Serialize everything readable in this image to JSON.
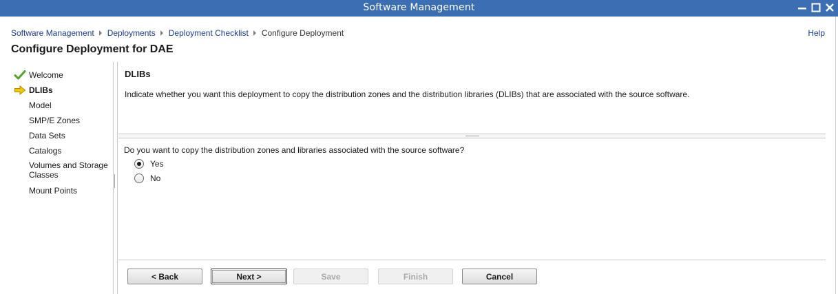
{
  "window": {
    "title": "Software Management"
  },
  "breadcrumb": {
    "items": [
      "Software Management",
      "Deployments",
      "Deployment Checklist"
    ],
    "current": "Configure Deployment"
  },
  "help_label": "Help",
  "page_title": "Configure Deployment for DAE",
  "wizard_steps": [
    {
      "label": "Welcome",
      "status": "complete",
      "icon": "check-icon"
    },
    {
      "label": "DLIBs",
      "status": "current",
      "icon": "arrow-right-icon"
    },
    {
      "label": "Model",
      "status": "pending"
    },
    {
      "label": "SMP/E Zones",
      "status": "pending"
    },
    {
      "label": "Data Sets",
      "status": "pending"
    },
    {
      "label": "Catalogs",
      "status": "pending"
    },
    {
      "label": "Volumes and Storage",
      "label_line2": "Classes",
      "status": "pending"
    },
    {
      "label": "Mount Points",
      "status": "pending"
    }
  ],
  "section": {
    "title": "DLIBs",
    "description": "Indicate whether you want this deployment to copy the distribution zones and the distribution libraries (DLIBs) that are associated with the source software."
  },
  "question": {
    "text": "Do you want to copy the distribution zones and libraries associated with the source software?",
    "options": [
      {
        "label": "Yes",
        "selected": true
      },
      {
        "label": "No",
        "selected": false
      }
    ]
  },
  "buttons": {
    "back": "< Back",
    "next": "Next >",
    "save": "Save",
    "finish": "Finish",
    "cancel": "Cancel"
  },
  "colors": {
    "titlebar": "#3c6eb4",
    "link": "#1a3c8c",
    "check_icon": "#5aa02c",
    "arrow_icon": "#f0c800"
  }
}
